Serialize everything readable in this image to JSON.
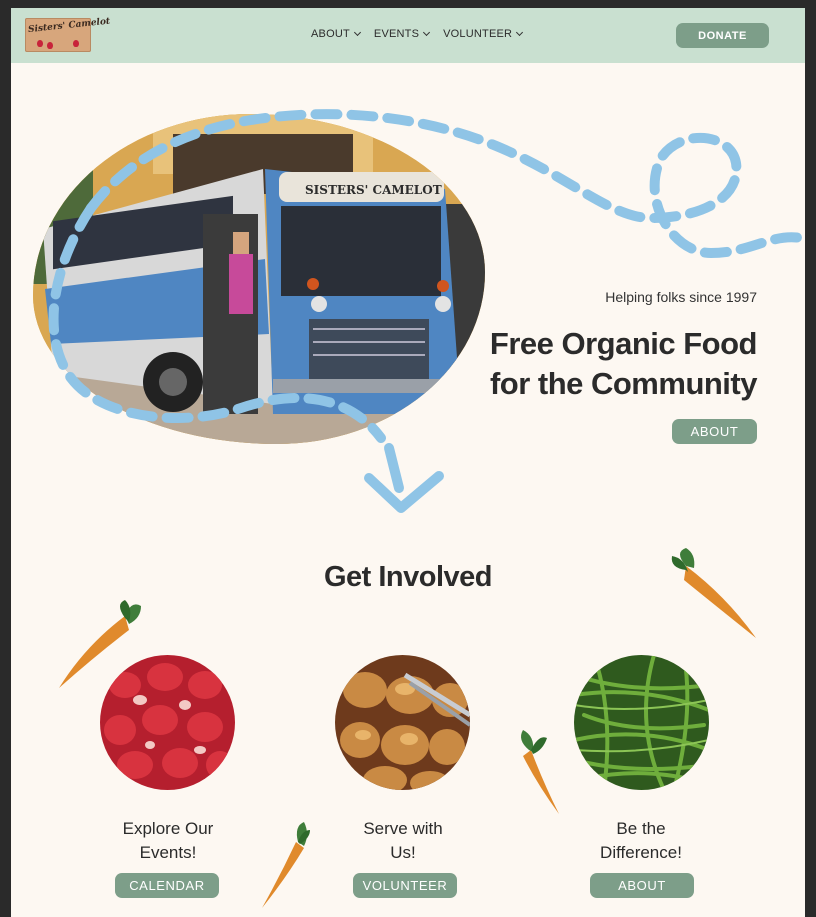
{
  "header": {
    "logo_text": "Sisters' Camelot",
    "nav": [
      {
        "label": "ABOUT"
      },
      {
        "label": "EVENTS"
      },
      {
        "label": "VOLUNTEER"
      }
    ],
    "donate_label": "DONATE"
  },
  "hero": {
    "image_label": "SISTERS' CAMELOT",
    "tagline": "Helping folks since 1997",
    "title_line1": "Free Organic Food",
    "title_line2": "for the Community",
    "button_label": "ABOUT"
  },
  "get_involved": {
    "title": "Get Involved",
    "cards": [
      {
        "title_line1": "Explore Our",
        "title_line2": "Events!",
        "button_label": "CALENDAR",
        "image": "strawberries"
      },
      {
        "title_line1": "Serve with",
        "title_line2": "Us!",
        "button_label": "VOLUNTEER",
        "image": "bread-rolls"
      },
      {
        "title_line1": "Be the",
        "title_line2": "Difference!",
        "button_label": "ABOUT",
        "image": "green-beans"
      }
    ]
  },
  "colors": {
    "header_bg": "#c9e0d0",
    "page_bg": "#fdf8f2",
    "button_green": "#7d9e89",
    "dash_blue": "#8fc4e6",
    "carrot_orange": "#e08a2c"
  },
  "icons": [
    "chevron-down-icon",
    "arrow-down-icon",
    "carrot-icon"
  ]
}
